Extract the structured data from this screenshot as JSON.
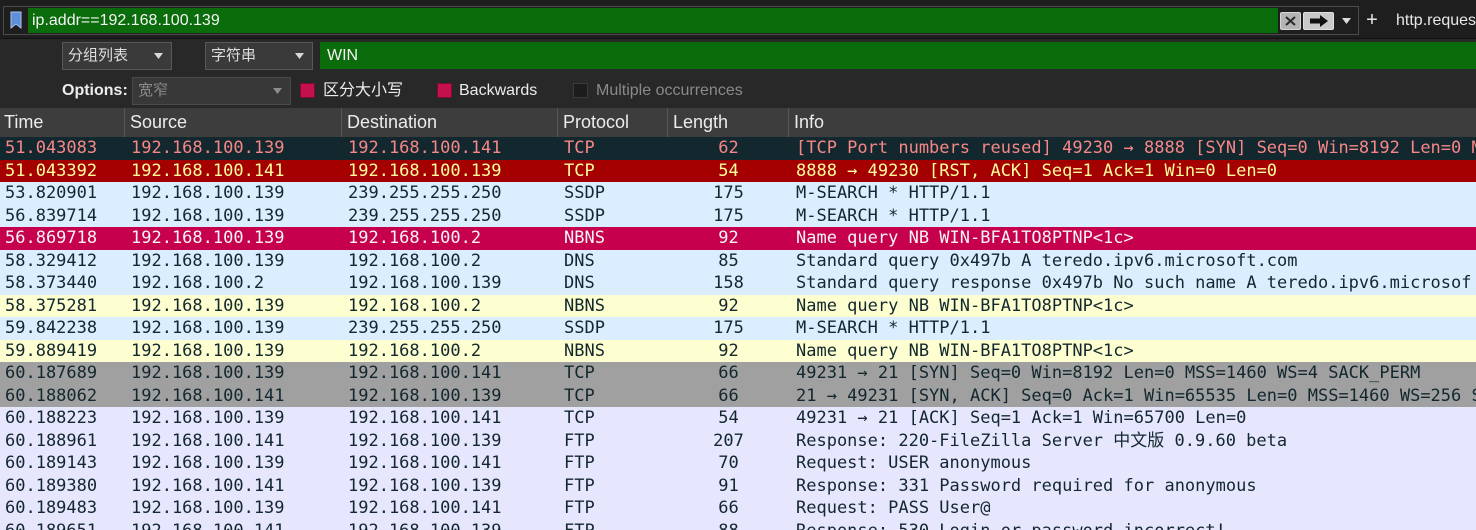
{
  "filter_bar": {
    "bookmark_icon": "bookmark-icon",
    "value": "ip.addr==192.168.100.139",
    "clear_icon": "clear-icon",
    "apply_icon": "arrow-right-icon",
    "recent_icon": "chevron-down-icon",
    "add_button_label": "+",
    "filter_button_label": "http.reques",
    "valid_color": "#0a6c0a"
  },
  "find_bar": {
    "search_in": "分组列表",
    "search_type": "字符串",
    "search_value": "WIN",
    "options_label": "Options:",
    "character_width": "宽窄",
    "case_sensitive_label": "区分大小写",
    "case_sensitive": true,
    "backwards_label": "Backwards",
    "backwards": true,
    "multiple_occurrences_label": "Multiple occurrences",
    "multiple_occurrences": false,
    "checked_color": "#c4114d"
  },
  "packet_list": {
    "columns": [
      "Time",
      "Source",
      "Destination",
      "Protocol",
      "Length",
      "Info"
    ],
    "rows": [
      {
        "time": "51.043083",
        "source": "192.168.100.139",
        "destination": "192.168.100.141",
        "protocol": "TCP",
        "length": 62,
        "info": "[TCP Port numbers reused] 49230 → 8888 [SYN] Seq=0 Win=8192 Len=0 M",
        "bg": "#12272E",
        "fg": "#F78787"
      },
      {
        "time": "51.043392",
        "source": "192.168.100.141",
        "destination": "192.168.100.139",
        "protocol": "TCP",
        "length": 54,
        "info": "8888 → 49230 [RST, ACK] Seq=1 Ack=1 Win=0 Len=0",
        "bg": "#A40000",
        "fg": "#FFFC9C"
      },
      {
        "time": "53.820901",
        "source": "192.168.100.139",
        "destination": "239.255.255.250",
        "protocol": "SSDP",
        "length": 175,
        "info": "M-SEARCH * HTTP/1.1",
        "bg": "#DAEEFF",
        "fg": "#12272E"
      },
      {
        "time": "56.839714",
        "source": "192.168.100.139",
        "destination": "239.255.255.250",
        "protocol": "SSDP",
        "length": 175,
        "info": "M-SEARCH * HTTP/1.1",
        "bg": "#DAEEFF",
        "fg": "#12272E"
      },
      {
        "time": "56.869718",
        "source": "192.168.100.139",
        "destination": "192.168.100.2",
        "protocol": "NBNS",
        "length": 92,
        "info": "Name query NB WIN-BFA1TO8PTNP<1c>",
        "bg": "#C6004C",
        "fg": "#F5F5F5"
      },
      {
        "time": "58.329412",
        "source": "192.168.100.139",
        "destination": "192.168.100.2",
        "protocol": "DNS",
        "length": 85,
        "info": "Standard query 0x497b A teredo.ipv6.microsoft.com",
        "bg": "#DAEEFF",
        "fg": "#12272E"
      },
      {
        "time": "58.373440",
        "source": "192.168.100.2",
        "destination": "192.168.100.139",
        "protocol": "DNS",
        "length": 158,
        "info": "Standard query response 0x497b No such name A teredo.ipv6.microsof",
        "bg": "#DAEEFF",
        "fg": "#12272E"
      },
      {
        "time": "58.375281",
        "source": "192.168.100.139",
        "destination": "192.168.100.2",
        "protocol": "NBNS",
        "length": 92,
        "info": "Name query NB WIN-BFA1TO8PTNP<1c>",
        "bg": "#FEFFD0",
        "fg": "#12272E"
      },
      {
        "time": "59.842238",
        "source": "192.168.100.139",
        "destination": "239.255.255.250",
        "protocol": "SSDP",
        "length": 175,
        "info": "M-SEARCH * HTTP/1.1",
        "bg": "#DAEEFF",
        "fg": "#12272E"
      },
      {
        "time": "59.889419",
        "source": "192.168.100.139",
        "destination": "192.168.100.2",
        "protocol": "NBNS",
        "length": 92,
        "info": "Name query NB WIN-BFA1TO8PTNP<1c>",
        "bg": "#FEFFD0",
        "fg": "#12272E"
      },
      {
        "time": "60.187689",
        "source": "192.168.100.139",
        "destination": "192.168.100.141",
        "protocol": "TCP",
        "length": 66,
        "info": "49231 → 21 [SYN] Seq=0 Win=8192 Len=0 MSS=1460 WS=4 SACK_PERM",
        "bg": "#A0A0A0",
        "fg": "#12272E"
      },
      {
        "time": "60.188062",
        "source": "192.168.100.141",
        "destination": "192.168.100.139",
        "protocol": "TCP",
        "length": 66,
        "info": "21 → 49231 [SYN, ACK] Seq=0 Ack=1 Win=65535 Len=0 MSS=1460 WS=256 S",
        "bg": "#A0A0A0",
        "fg": "#12272E"
      },
      {
        "time": "60.188223",
        "source": "192.168.100.139",
        "destination": "192.168.100.141",
        "protocol": "TCP",
        "length": 54,
        "info": "49231 → 21 [ACK] Seq=1 Ack=1 Win=65700 Len=0",
        "bg": "#E7E6FF",
        "fg": "#12272E"
      },
      {
        "time": "60.188961",
        "source": "192.168.100.141",
        "destination": "192.168.100.139",
        "protocol": "FTP",
        "length": 207,
        "info": "Response: 220-FileZilla Server 中文版 0.9.60 beta",
        "bg": "#E7E6FF",
        "fg": "#12272E"
      },
      {
        "time": "60.189143",
        "source": "192.168.100.139",
        "destination": "192.168.100.141",
        "protocol": "FTP",
        "length": 70,
        "info": "Request: USER anonymous",
        "bg": "#E7E6FF",
        "fg": "#12272E"
      },
      {
        "time": "60.189380",
        "source": "192.168.100.141",
        "destination": "192.168.100.139",
        "protocol": "FTP",
        "length": 91,
        "info": "Response: 331 Password required for anonymous",
        "bg": "#E7E6FF",
        "fg": "#12272E"
      },
      {
        "time": "60.189483",
        "source": "192.168.100.139",
        "destination": "192.168.100.141",
        "protocol": "FTP",
        "length": 66,
        "info": "Request: PASS User@",
        "bg": "#E7E6FF",
        "fg": "#12272E"
      },
      {
        "time": "60.189651",
        "source": "192.168.100.141",
        "destination": "192.168.100.139",
        "protocol": "FTP",
        "length": 88,
        "info": "Response: 530 Login or password incorrect!",
        "bg": "#E7E6FF",
        "fg": "#12272E"
      }
    ]
  }
}
